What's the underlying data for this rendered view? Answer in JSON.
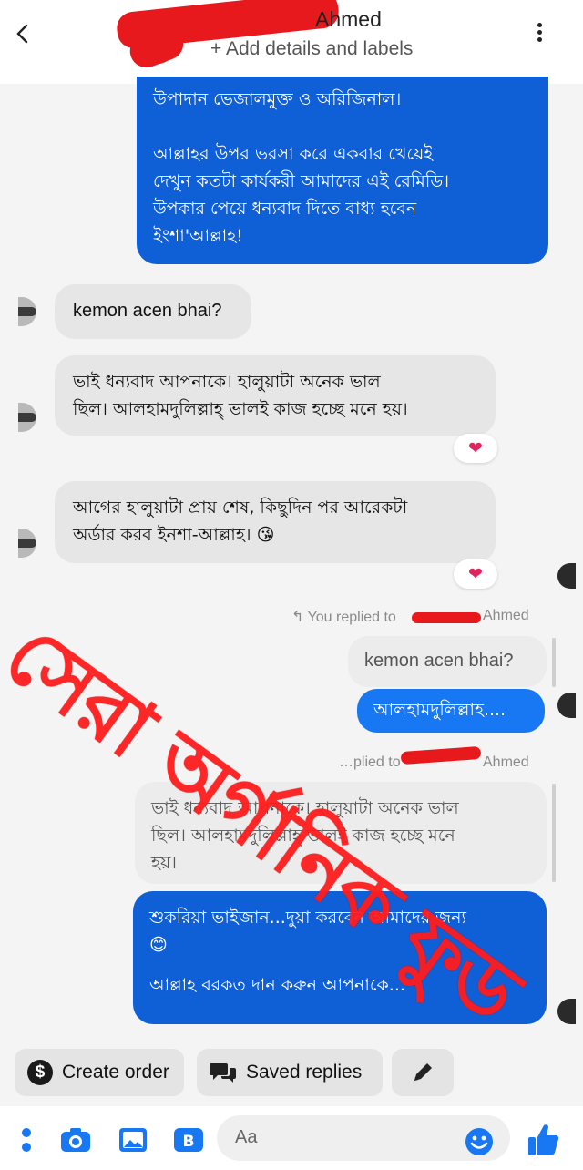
{
  "header": {
    "contact_name_visible": "Ahmed",
    "add_details": "+ Add details and labels"
  },
  "messages": {
    "outgoing_1": "উপাদান ভেজালমুক্ত ও অরিজিনাল।\n\nআল্লাহর উপর ভরসা করে একবার খেয়েই\nদেখুন কতটা কার্যকরী আমাদের এই রেমিডি।\nউপকার পেয়ে ধন্যবাদ দিতে বাধ্য হবেন\nইংশা'আল্লাহ!",
    "incoming_1": "kemon acen bhai?",
    "incoming_2": "ভাই ধন্যবাদ আপনাকে। হালুয়াটা অনেক ভাল\nছিল। আলহামদুলিল্লাহ্‌ ভালই কাজ হচ্ছে মনে হয়।",
    "incoming_3": "আগের হালুয়াটা প্রায় শেষ, কিছুদিন পর আরেকটা\nঅর্ডার করব ইনশা-আল্লাহ।",
    "incoming_3_emoji": "😘",
    "reaction": "❤",
    "reply_label_1_prefix": "You replied to",
    "reply_label_1_name": "Ahmed",
    "quoted_1": "kemon acen bhai?",
    "outgoing_2": "আলহামদুলিল্লাহ....",
    "reply_label_2_prefix": "…plied to",
    "reply_label_2_name": "Ahmed",
    "quoted_2": "ভাই ধন্যবাদ আপনাকে। হালুয়াটা অনেক ভাল\nছিল। আলহামদুলিল্লাহ্‌ ভালই কাজ হচ্ছে মনে\nহয়।",
    "outgoing_3": "শুকরিয়া ভাইজান...দুয়া করবেন আমাদের জন্য",
    "outgoing_3_emoji": "😊",
    "outgoing_3_line2": "আল্লাহ বরকত দান করুন আপনাকে..."
  },
  "watermark": "সেরা অর্গানিক ফুড",
  "actions": {
    "create_order": "Create order",
    "saved_replies": "Saved replies",
    "dollar_symbol": "$"
  },
  "composer": {
    "placeholder": "Aa"
  },
  "colors": {
    "messenger_blue": "#1877f2",
    "incoming_bubble": "#e6e6e6",
    "watermark_red": "#ff1d1d",
    "redaction_red": "#e8191c"
  },
  "icons": [
    "back-arrow-icon",
    "more-vertical-icon",
    "heart-icon",
    "reply-arrow-icon",
    "dollar-icon",
    "saved-replies-icon",
    "pencil-icon",
    "menu-dots-icon",
    "camera-icon",
    "gallery-icon",
    "sticker-icon",
    "emoji-icon",
    "thumbs-up-icon"
  ]
}
